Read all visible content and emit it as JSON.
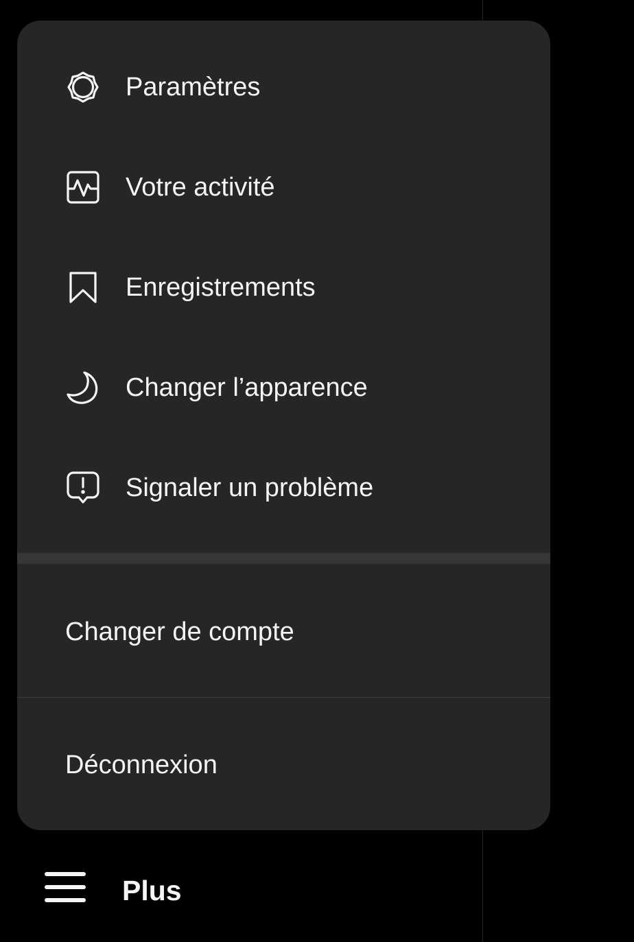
{
  "menu": {
    "items": [
      {
        "label": "Paramètres",
        "icon": "settings-gear-icon"
      },
      {
        "label": "Votre activité",
        "icon": "activity-icon"
      },
      {
        "label": "Enregistrements",
        "icon": "bookmark-icon"
      },
      {
        "label": "Changer l’apparence",
        "icon": "moon-icon"
      },
      {
        "label": "Signaler un problème",
        "icon": "report-problem-icon"
      }
    ],
    "switch_account_label": "Changer de compte",
    "logout_label": "Déconnexion"
  },
  "more_button": {
    "label": "Plus",
    "icon": "hamburger-menu-icon"
  },
  "colors": {
    "background": "#000000",
    "panel": "#262626",
    "text": "#f5f5f5",
    "separator": "#363636"
  }
}
